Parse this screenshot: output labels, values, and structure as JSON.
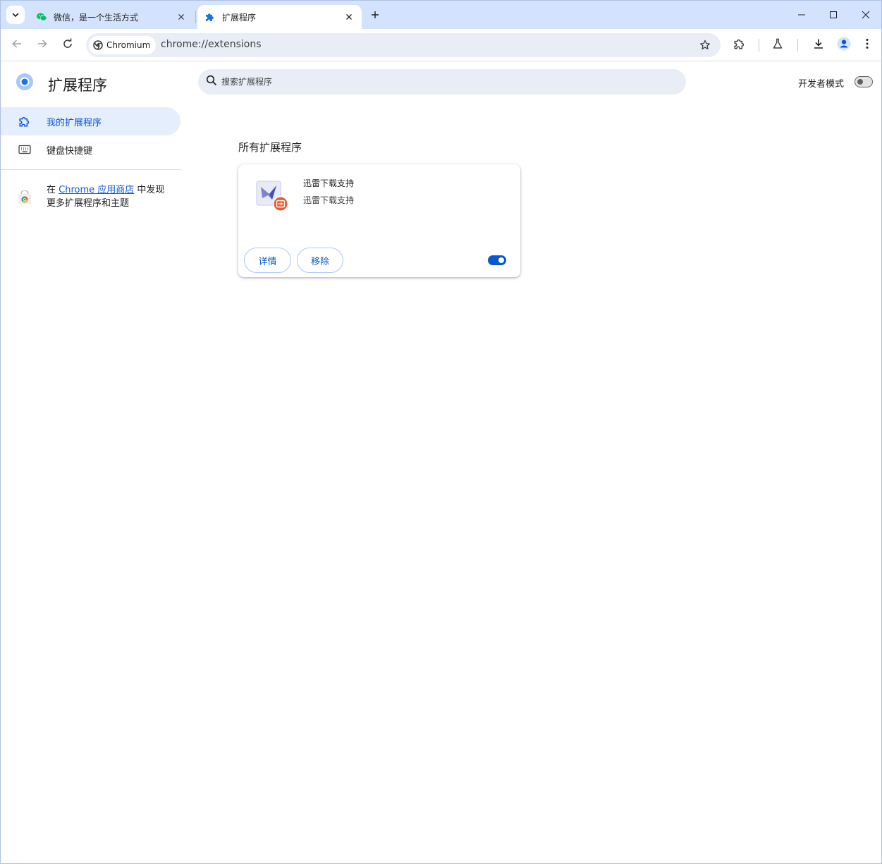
{
  "browser": {
    "tabs": [
      {
        "title": "微信，是一个生活方式",
        "active": false,
        "favicon": "wechat-icon"
      },
      {
        "title": "扩展程序",
        "active": true,
        "favicon": "puzzle-icon"
      }
    ],
    "omnibox": {
      "chip_label": "Chromium",
      "url": "chrome://extensions"
    },
    "colors": {
      "tabstrip": "#d3e3fd",
      "omnibox": "#e9eef6",
      "accent": "#0b57d0"
    }
  },
  "extensions_page": {
    "title": "扩展程序",
    "search_placeholder": "搜索扩展程序",
    "dev_mode": {
      "label": "开发者模式",
      "enabled": false
    },
    "sidebar": {
      "items": [
        {
          "label": "我的扩展程序",
          "icon": "extension-icon",
          "selected": true
        },
        {
          "label": "键盘快捷键",
          "icon": "keyboard-icon",
          "selected": false
        }
      ],
      "store_promo": {
        "prefix": "在 ",
        "link_text": "Chrome 应用商店",
        "suffix": " 中发现更多扩展程序和主题"
      }
    },
    "section_title": "所有扩展程序",
    "extensions": [
      {
        "name": "迅雷下载支持",
        "description": "迅雷下载支持",
        "details_label": "详情",
        "remove_label": "移除",
        "enabled": true,
        "icon": "thunder-download-icon"
      }
    ]
  }
}
